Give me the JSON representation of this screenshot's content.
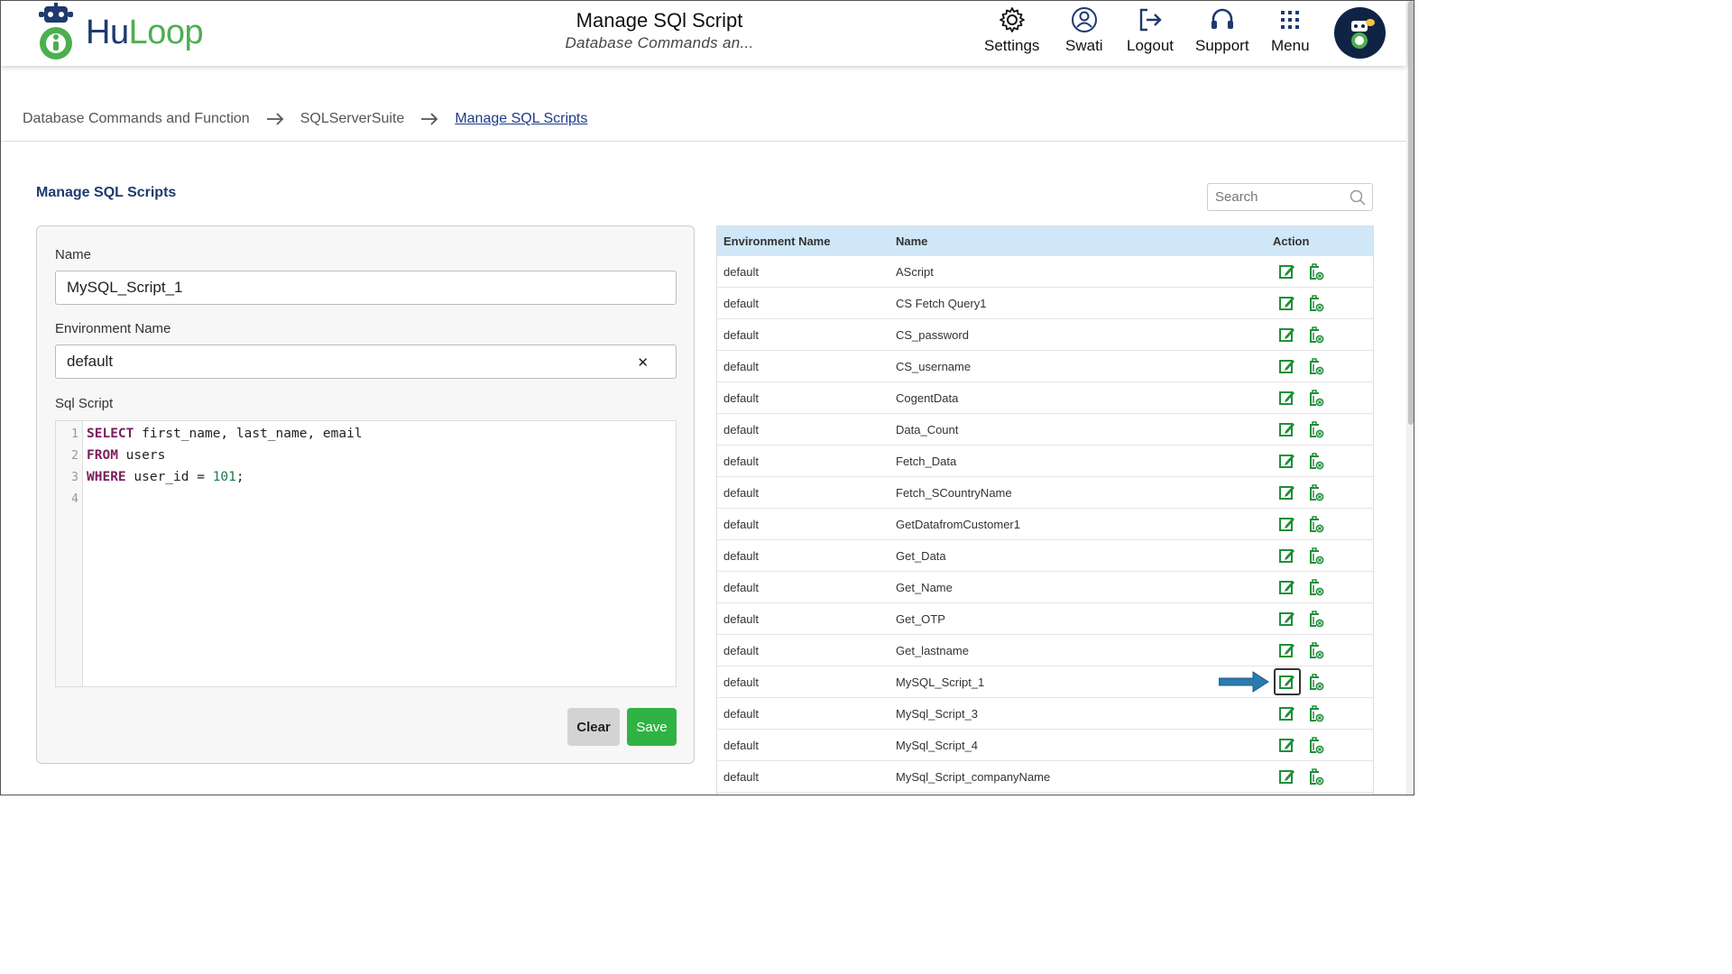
{
  "header": {
    "logo_text_a": "Hu",
    "logo_text_b": "Loop",
    "title": "Manage SQl Script",
    "subtitle": "Database Commands an...",
    "nav": [
      {
        "label": "Settings",
        "icon": "gear-icon"
      },
      {
        "label": "Swati",
        "icon": "user-icon"
      },
      {
        "label": "Logout",
        "icon": "logout-icon"
      },
      {
        "label": "Support",
        "icon": "headset-icon"
      },
      {
        "label": "Menu",
        "icon": "grid-icon"
      }
    ]
  },
  "breadcrumb": {
    "items": [
      "Database Commands and Function",
      "SQLServerSuite",
      "Manage SQL Scripts"
    ]
  },
  "section_title": "Manage SQL Scripts",
  "form": {
    "name_label": "Name",
    "name_value": "MySQL_Script_1",
    "env_label": "Environment Name",
    "env_value": "default",
    "script_label": "Sql Script",
    "code": {
      "line1_kw": "SELECT",
      "line1_rest": " first_name, last_name, email",
      "line2_kw": "FROM",
      "line2_rest": " users",
      "line3_kw": "WHERE",
      "line3_mid": " user_id = ",
      "line3_num": "101",
      "line3_end": ";",
      "line_numbers": [
        "1",
        "2",
        "3",
        "4"
      ]
    },
    "clear_label": "Clear",
    "save_label": "Save"
  },
  "search": {
    "placeholder": "Search"
  },
  "table": {
    "headers": {
      "env": "Environment Name",
      "name": "Name",
      "action": "Action"
    },
    "rows": [
      {
        "env": "default",
        "name": "AScript"
      },
      {
        "env": "default",
        "name": "CS Fetch Query1"
      },
      {
        "env": "default",
        "name": "CS_password"
      },
      {
        "env": "default",
        "name": "CS_username"
      },
      {
        "env": "default",
        "name": "CogentData"
      },
      {
        "env": "default",
        "name": "Data_Count"
      },
      {
        "env": "default",
        "name": "Fetch_Data"
      },
      {
        "env": "default",
        "name": "Fetch_SCountryName"
      },
      {
        "env": "default",
        "name": "GetDatafromCustomer1"
      },
      {
        "env": "default",
        "name": "Get_Data"
      },
      {
        "env": "default",
        "name": "Get_Name"
      },
      {
        "env": "default",
        "name": "Get_OTP"
      },
      {
        "env": "default",
        "name": "Get_lastname"
      },
      {
        "env": "default",
        "name": "MySQL_Script_1"
      },
      {
        "env": "default",
        "name": "MySql_Script_3"
      },
      {
        "env": "default",
        "name": "MySql_Script_4"
      },
      {
        "env": "default",
        "name": "MySql_Script_companyName"
      }
    ],
    "highlighted_row": "MySQL_Script_1"
  },
  "colors": {
    "brand_navy": "#1e3a6e",
    "brand_green": "#4caf50",
    "action_green": "#1f8f3a",
    "save_green": "#2fb344",
    "header_blue": "#cfe7f7",
    "pointer_blue": "#2b7bb0"
  }
}
